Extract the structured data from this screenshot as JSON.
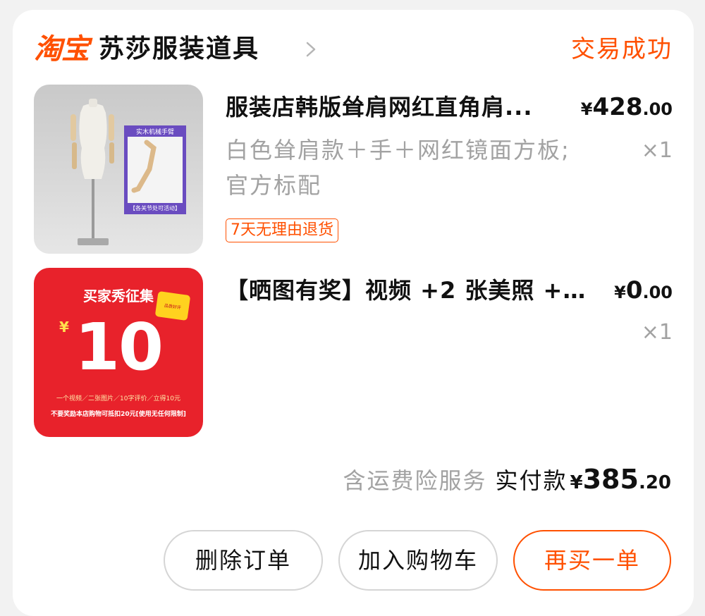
{
  "shop": {
    "platform_logo": "淘宝",
    "name": "苏莎服装道具",
    "status": "交易成功"
  },
  "items": [
    {
      "title": "服装店韩版耸肩网红直角肩...",
      "price_symbol": "¥",
      "price_int": "428",
      "price_dec": ".00",
      "sku": "白色耸肩款＋手＋网红镜面方板;官方标配",
      "qty": "×1",
      "badge": "7天无理由退货",
      "image_label_top": "实木机械手臂",
      "image_label_bottom": "【各关节处可活动】"
    },
    {
      "title": "【晒图有奖】视频 +2 张美照 +1...",
      "price_symbol": "¥",
      "price_int": "0",
      "price_dec": ".00",
      "qty": "×1",
      "image_heading": "买家秀征集",
      "image_symbol": "¥",
      "image_amount": "10",
      "image_line1": "一个视频／二张图片／10字评价／立得10元",
      "image_line2": "不要奖励本店购物可抵扣20元[使用无任何限制]",
      "image_tag": "品质好评"
    }
  ],
  "summary": {
    "insurance": "含运费险服务",
    "paid_label": "实付款",
    "symbol": "¥",
    "int": "385",
    "dec": ".20"
  },
  "buttons": {
    "delete": "删除订单",
    "add_cart": "加入购物车",
    "rebuy": "再买一单"
  },
  "colors": {
    "accent": "#ff5000",
    "promo_red": "#e8222b",
    "muted_text": "#a2a2a2"
  }
}
